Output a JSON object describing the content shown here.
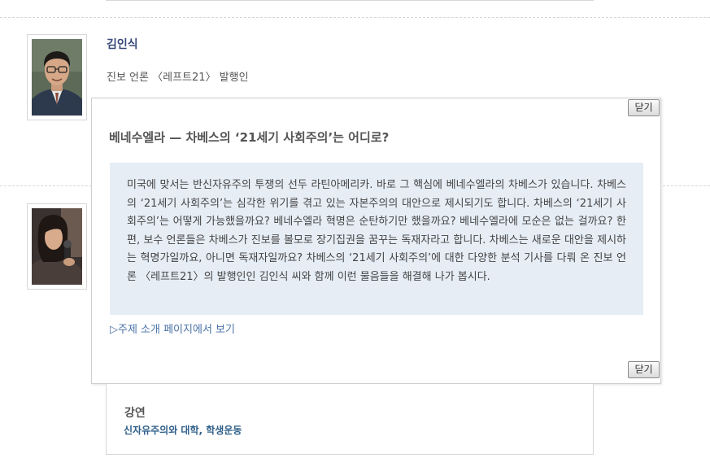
{
  "speaker1": {
    "name": "김인식",
    "role": "진보 언론 〈레프트21〉 발행인"
  },
  "popup": {
    "close_label_top": "닫기",
    "close_label_bottom": "닫기",
    "title": "베네수엘라 — 차베스의 ‘21세기 사회주의’는 어디로?",
    "description": "미국에 맞서는 반신자유주의 투쟁의 선두 라틴아메리카. 바로 그 핵심에 베네수엘라의 차베스가 있습니다. 차베스의 ‘21세기 사회주의’는 심각한 위기를 겪고 있는 자본주의의 대안으로 제시되기도 합니다. 차베스의 ‘21세기 사회주의’는 어떻게 가능했을까요? 베네수엘라 혁명은 순탄하기만 했을까요? 베네수엘라에 모순은 없는 걸까요? 한편, 보수 언론들은 차베스가 진보를 볼모로 장기집권을 꿈꾸는 독재자라고 합니다. 차베스는 새로운 대안을 제시하는 혁명가일까요, 아니면 독재자일까요? 차베스의 ‘21세기 사회주의’에 대한 다양한 분석 기사를 다뤄 온 진보 언론 〈레프트21〉의 발행인인 김인식 씨와 함께 이런 물음들을 해결해 나가 봅시다.",
    "topic_link": "▷주제 소개 페이지에서 보기"
  },
  "lecture": {
    "heading": "강연",
    "link": "신자유주의와 대학, 학생운동"
  },
  "colors": {
    "desc_background": "#e6edf5",
    "link_blue": "#4a73a8",
    "name_navy": "#3a4a7a"
  }
}
